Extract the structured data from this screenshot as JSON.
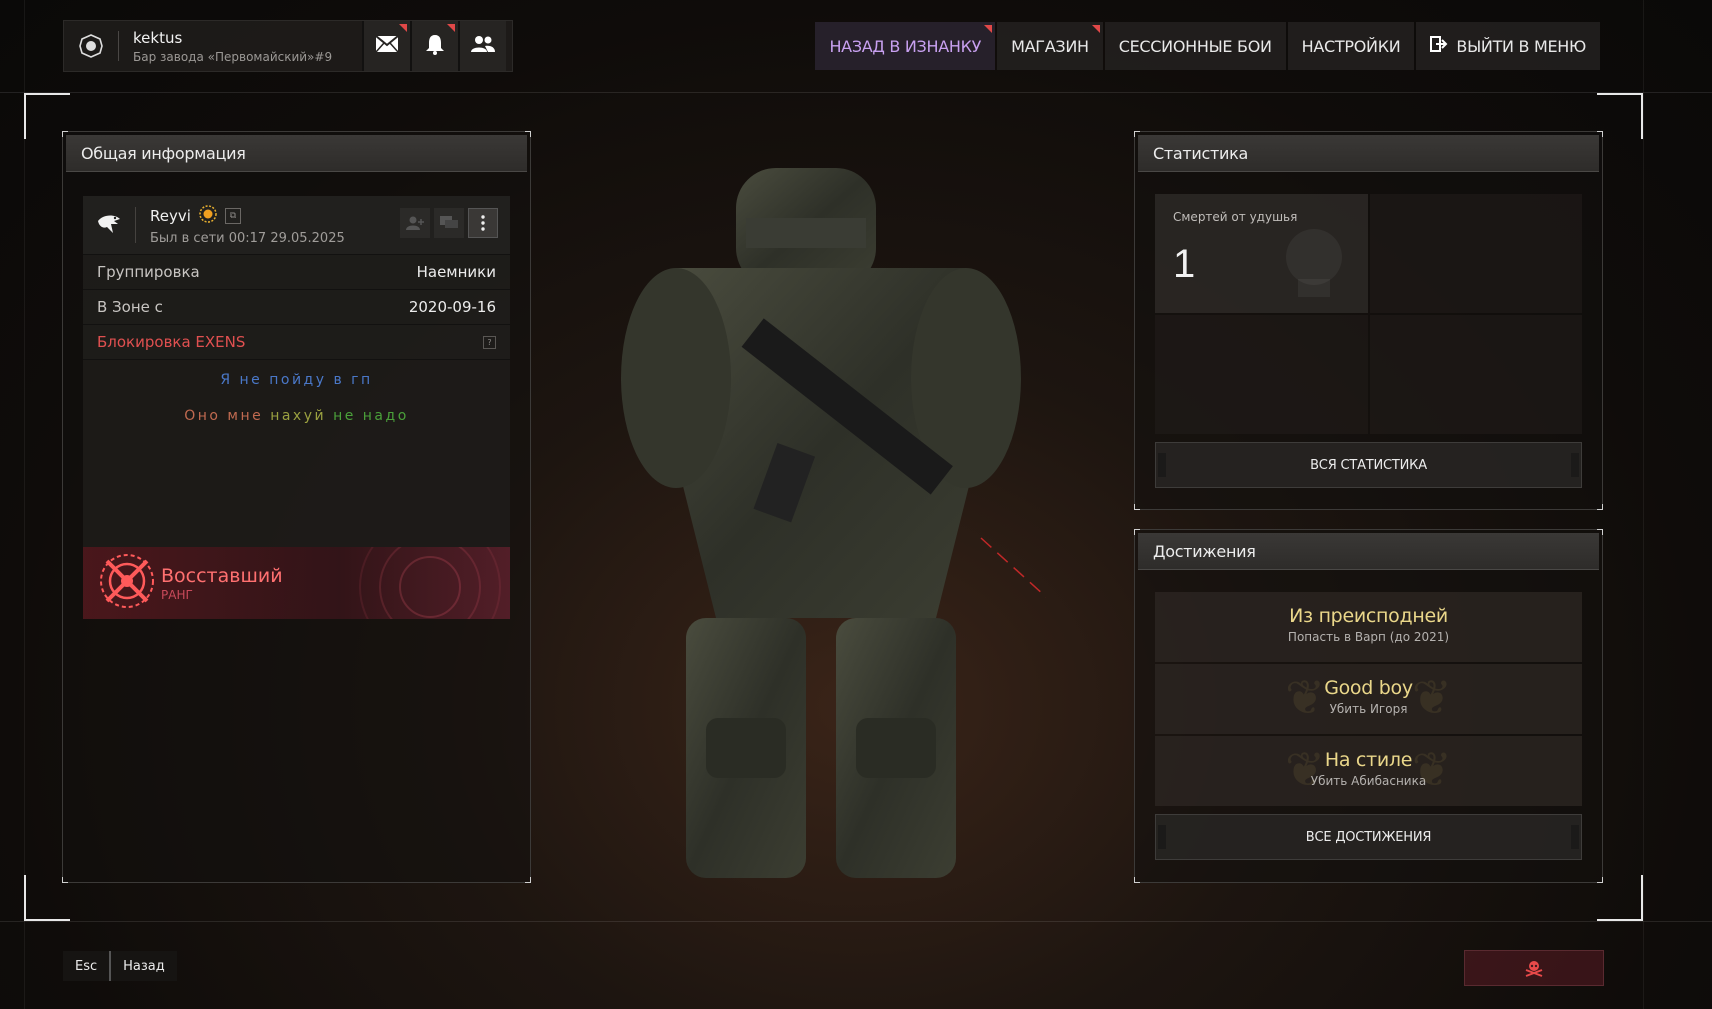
{
  "topbar": {
    "profile": {
      "name": "kektus",
      "location": "Бар завода «Первомайский»#9"
    },
    "icons": [
      "mail-icon",
      "bell-icon",
      "friends-icon"
    ],
    "nav": [
      {
        "label": "НАЗАД В ИЗНАНКУ",
        "active": true,
        "flag": true
      },
      {
        "label": "МАГАЗИН",
        "active": false,
        "flag": true
      },
      {
        "label": "СЕССИОННЫЕ БОИ",
        "active": false,
        "flag": false
      },
      {
        "label": "НАСТРОЙКИ",
        "active": false,
        "flag": false
      },
      {
        "label": "ВЫЙТИ В МЕНЮ",
        "active": false,
        "flag": false
      }
    ]
  },
  "general": {
    "title": "Общая информация",
    "player": {
      "name": "Reyvi",
      "last_seen": "Был в сети 00:17 29.05.2025"
    },
    "rows": [
      {
        "key": "Группировка",
        "value": "Наемники"
      },
      {
        "key": "В Зоне с",
        "value": "2020-09-16"
      }
    ],
    "block_label": "Блокировка EXENS",
    "status_line1": "Я не пойду в гп",
    "status_line2_parts": [
      {
        "text": "Оно мне ",
        "color": "#c06a50"
      },
      {
        "text": "нахуй ",
        "color": "#9aa040"
      },
      {
        "text": "не надо",
        "color": "#4aa03a"
      }
    ],
    "rank": {
      "name": "Восставший",
      "label": "РАНГ"
    }
  },
  "stats": {
    "title": "Статистика",
    "cell_label": "Смертей от удушья",
    "cell_value": "1",
    "button": "ВСЯ СТАТИСТИКА"
  },
  "achievements": {
    "title": "Достижения",
    "items": [
      {
        "title": "Из преисподней",
        "desc": "Попасть в Варп (до 2021)"
      },
      {
        "title": "Good boy",
        "desc": "Убить Игоря"
      },
      {
        "title": "На стиле",
        "desc": "Убить Абибасника"
      }
    ],
    "button": "ВСЕ ДОСТИЖЕНИЯ"
  },
  "footer": {
    "esc": "Esc",
    "back": "Назад"
  },
  "colors": {
    "accent_purple": "#c8a0f0",
    "alert_red": "#e04848",
    "gold": "#ead78a"
  }
}
